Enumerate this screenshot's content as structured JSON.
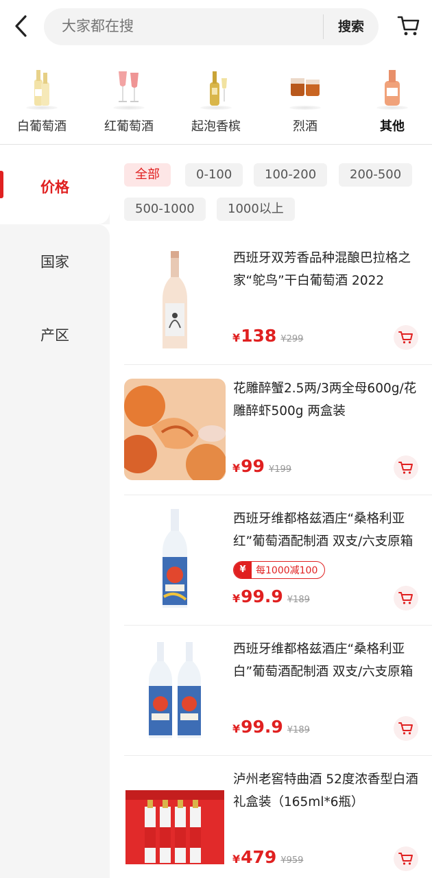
{
  "header": {
    "search_placeholder": "大家都在搜",
    "search_button": "搜索"
  },
  "categories": [
    {
      "label": "白葡萄酒",
      "icon": "white-wine-bottle-icon",
      "active": false
    },
    {
      "label": "红葡萄酒",
      "icon": "red-wine-glass-icon",
      "active": false
    },
    {
      "label": "起泡香槟",
      "icon": "champagne-icon",
      "active": false
    },
    {
      "label": "烈酒",
      "icon": "spirits-glass-icon",
      "active": false
    },
    {
      "label": "其他",
      "icon": "other-bottle-icon",
      "active": true
    }
  ],
  "sidebar": {
    "items": [
      {
        "label": "价格",
        "active": true
      },
      {
        "label": "国家",
        "active": false
      },
      {
        "label": "产区",
        "active": false
      }
    ]
  },
  "filters": [
    "全部",
    "0-100",
    "100-200",
    "200-500",
    "500-1000",
    "1000以上"
  ],
  "products": [
    {
      "title": "西班牙双芳香品种混酿巴拉格之家“鸵鸟”干白葡萄酒 2022",
      "currency": "¥",
      "price": "138",
      "original_price": "¥299",
      "coupon": ""
    },
    {
      "title": "花雕醉蟹2.5两/3两全母600g/花雕醉虾500g 两盒装",
      "currency": "¥",
      "price": "99",
      "original_price": "¥199",
      "coupon": ""
    },
    {
      "title": "西班牙维都格兹酒庄“桑格利亚红”葡萄酒配制酒 双支/六支原箱",
      "currency": "¥",
      "price": "99.9",
      "original_price": "¥189",
      "coupon": "每1000减100",
      "coupon_icon": "¥"
    },
    {
      "title": "西班牙维都格兹酒庄“桑格利亚白”葡萄酒配制酒 双支/六支原箱",
      "currency": "¥",
      "price": "99.9",
      "original_price": "¥189",
      "coupon": ""
    },
    {
      "title": "泸州老窖特曲酒 52度浓香型白酒 礼盒装（165ml*6瓶）",
      "currency": "¥",
      "price": "479",
      "original_price": "¥959",
      "coupon": ""
    }
  ],
  "colors": {
    "accent": "#e02020",
    "sidebar_bg": "#f5f5f5",
    "chip_bg": "#f2f2f2"
  }
}
